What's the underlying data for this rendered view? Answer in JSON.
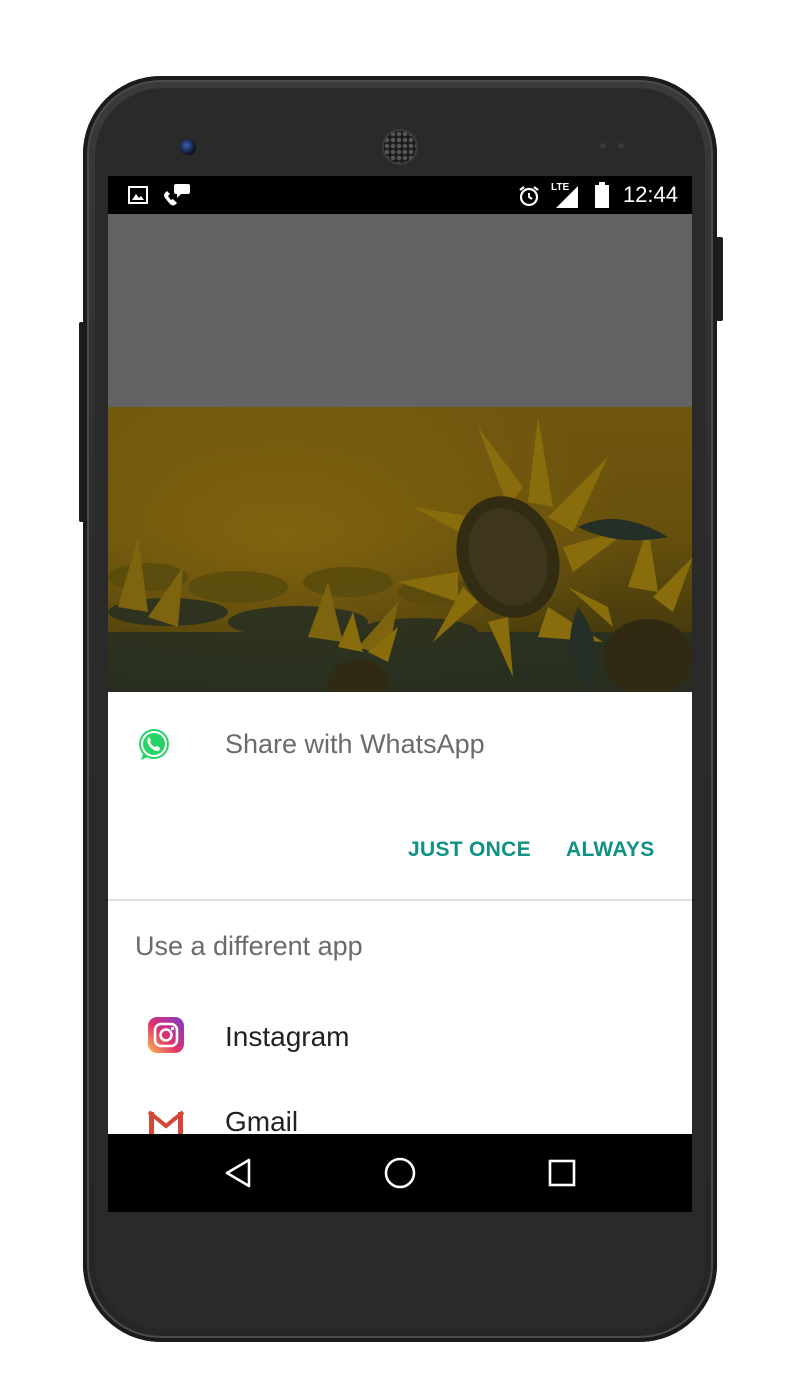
{
  "status_bar": {
    "time": "12:44",
    "network": "LTE",
    "icons": [
      "image-icon",
      "missed-call-icon",
      "alarm-icon",
      "signal-icon",
      "battery-icon"
    ]
  },
  "share_dialog": {
    "app_icon": "whatsapp-icon",
    "title": "Share with WhatsApp",
    "just_once_label": "JUST ONCE",
    "always_label": "ALWAYS",
    "different_app_label": "Use a different app",
    "apps": [
      {
        "name": "Instagram",
        "icon": "instagram-icon"
      },
      {
        "name": "Gmail",
        "icon": "gmail-icon"
      }
    ]
  },
  "nav_bar": {
    "icons": [
      "back-icon",
      "home-icon",
      "recents-icon"
    ]
  },
  "colors": {
    "accent": "#0f9184",
    "scrim": "#636363",
    "whatsapp_green": "#25d366"
  }
}
